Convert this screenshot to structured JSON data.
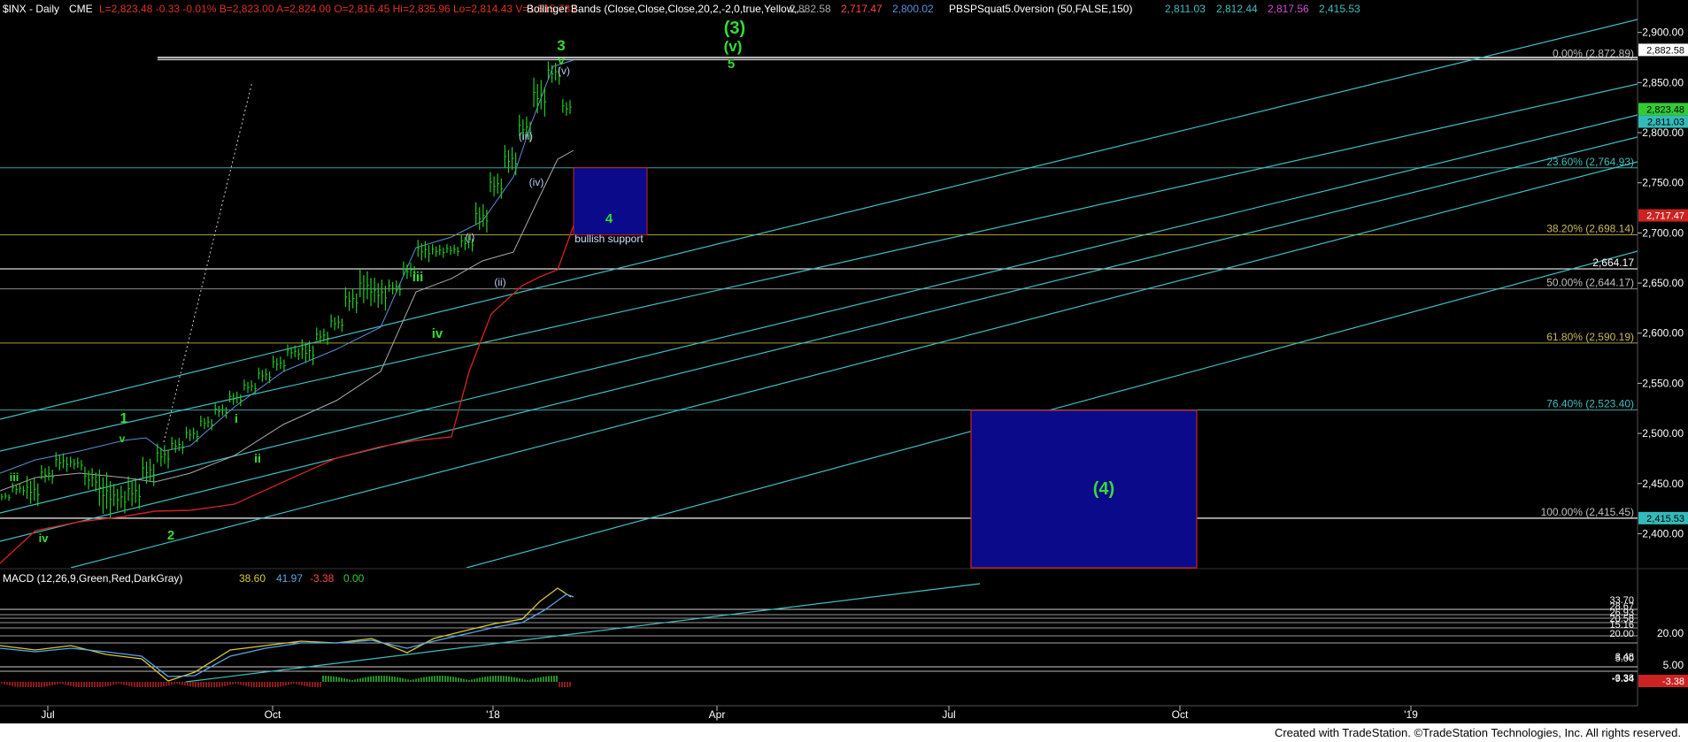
{
  "header": {
    "symbol": "$INX - Daily",
    "exchange": "CME",
    "quote": "L=2,823.48  -0.33  -0.01%  B=2,823.00  A=2,824.00  O=2,816.45  Hi=2,835.96  Lo=2,814.43  V=1,515,733",
    "bb_label": "Bollinger Bands (Close,Close,Close,20,2,-2,0,true,Yellow,...",
    "bb_values": [
      "2,882.58",
      "2,717.47",
      "2,800.02"
    ],
    "pbsp_label": "PBSPSquat5.0version (50,FALSE,150)",
    "pbsp_values": [
      "2,811.03",
      "2,812.44",
      "2,817.56",
      "2,415.53"
    ]
  },
  "macd_header": {
    "label": "MACD (12,26,9,Green,Red,DarkGray)",
    "values": [
      "38.60",
      "41.97",
      "-3.38",
      "0.00"
    ]
  },
  "colors": {
    "background": "#000000",
    "bars": "#22cc22",
    "channel": "#3fbfbf",
    "bb_gray": "#aaaaaa",
    "bb_red": "#cc2222",
    "bb_blue": "#5a8fd6",
    "wave_label": "#33dd33",
    "sub_wave_label": "#b8c8ee",
    "box_fill": "#0a0a8a",
    "box_border": "#cc2222",
    "macd_line": "#d8c83a",
    "signal_line": "#5aa6e6",
    "hist": "#cc2222",
    "hist_pos": "#33cc33"
  },
  "chart_data": {
    "type": "candlestick",
    "title": "$INX - Daily",
    "x_ticks": [
      "Jul",
      "Oct",
      "'18",
      "Apr",
      "Jul",
      "Oct",
      "'19"
    ],
    "y_ticks": [
      "2,900.00",
      "2,850.00",
      "2,800.00",
      "2,750.00",
      "2,700.00",
      "2,650.00",
      "2,600.00",
      "2,550.00",
      "2,500.00",
      "2,450.00",
      "2,400.00"
    ],
    "ylim": [
      2366,
      2920
    ],
    "price_series": [
      [
        2442,
        2432
      ],
      [
        2452,
        2437
      ],
      [
        2460,
        2425
      ],
      [
        2470,
        2448
      ],
      [
        2483,
        2460
      ],
      [
        2478,
        2462
      ],
      [
        2469,
        2440
      ],
      [
        2468,
        2412
      ],
      [
        2452,
        2418
      ],
      [
        2460,
        2422
      ],
      [
        2479,
        2445
      ],
      [
        2492,
        2463
      ],
      [
        2498,
        2478
      ],
      [
        2508,
        2490
      ],
      [
        2519,
        2502
      ],
      [
        2531,
        2514
      ],
      [
        2544,
        2526
      ],
      [
        2555,
        2538
      ],
      [
        2567,
        2549
      ],
      [
        2579,
        2560
      ],
      [
        2590,
        2572
      ],
      [
        2596,
        2566
      ],
      [
        2607,
        2587
      ],
      [
        2620,
        2600
      ],
      [
        2648,
        2618
      ],
      [
        2667,
        2624
      ],
      [
        2658,
        2620
      ],
      [
        2655,
        2636
      ],
      [
        2673,
        2651
      ],
      [
        2695,
        2669
      ],
      [
        2690,
        2674
      ],
      [
        2690,
        2676
      ],
      [
        2700,
        2680
      ],
      [
        2733,
        2698
      ],
      [
        2763,
        2732
      ],
      [
        2790,
        2755
      ],
      [
        2820,
        2788
      ],
      [
        2858,
        2813
      ],
      [
        2873,
        2846
      ],
      [
        2835,
        2814
      ]
    ],
    "fib_levels": [
      {
        "label": "0.00% (2,872.89)",
        "value": 2872.89
      },
      {
        "label": "23.60% (2,764.93)",
        "value": 2764.93
      },
      {
        "label": "38.20% (2,698.14)",
        "value": 2698.14
      },
      {
        "label": "50.00% (2,644.17)",
        "value": 2644.17
      },
      {
        "label": "61.80% (2,590.19)",
        "value": 2590.19
      },
      {
        "label": "76.40% (2,523.40)",
        "value": 2523.4
      },
      {
        "label": "100.00% (2,415.45)",
        "value": 2415.45
      }
    ],
    "horizontal_line_label": {
      "label": "2,664.17",
      "value": 2664.17
    },
    "axis_badges": [
      {
        "text": "2,882.58",
        "value": 2882.58
      },
      {
        "text": "2,823.48",
        "value": 2823.48
      },
      {
        "text": "2,811.03",
        "value": 2811.03
      },
      {
        "text": "2,717.47",
        "value": 2717.47
      },
      {
        "text": "2,415.53",
        "value": 2415.53
      }
    ],
    "wave_labels": [
      {
        "text": "3",
        "value": 2905
      },
      {
        "text": "v",
        "value": 2892
      },
      {
        "text": "(3)",
        "value": 2935
      },
      {
        "text": "(v)",
        "value": 2919
      },
      {
        "text": "5",
        "value": 2899
      },
      {
        "text": "iii",
        "value": 2668
      },
      {
        "text": "iv",
        "value": 2616
      },
      {
        "text": "1",
        "value": 2517
      },
      {
        "text": "v",
        "value": 2497
      },
      {
        "text": "i",
        "value": 2518
      },
      {
        "text": "ii",
        "value": 2475
      },
      {
        "text": "iii",
        "value": 2458
      },
      {
        "text": "iv",
        "value": 2405
      },
      {
        "text": "2",
        "value": 2398
      }
    ],
    "sub_wave_labels": [
      {
        "text": "(v)",
        "value": 2881
      },
      {
        "text": "(iii)",
        "value": 2836
      },
      {
        "text": "(iv)",
        "value": 2777
      },
      {
        "text": "(i)",
        "value": 2709
      },
      {
        "text": "(ii)",
        "value": 2662
      }
    ],
    "boxes": [
      {
        "label": "4",
        "sublabel": "bullish support",
        "top": 2765,
        "bottom": 2698
      },
      {
        "label": "(4)",
        "top": 2523,
        "bottom": 2366
      }
    ],
    "macd": {
      "right_labels": [
        "33.70",
        "28.67",
        "26.93",
        "20.58",
        "15.16",
        "20.00",
        "5.00",
        "3.48",
        "-9.34",
        "-3.38"
      ]
    }
  },
  "footer": {
    "credit": "Created with TradeStation. ©TradeStation Technologies, Inc. All rights reserved."
  }
}
